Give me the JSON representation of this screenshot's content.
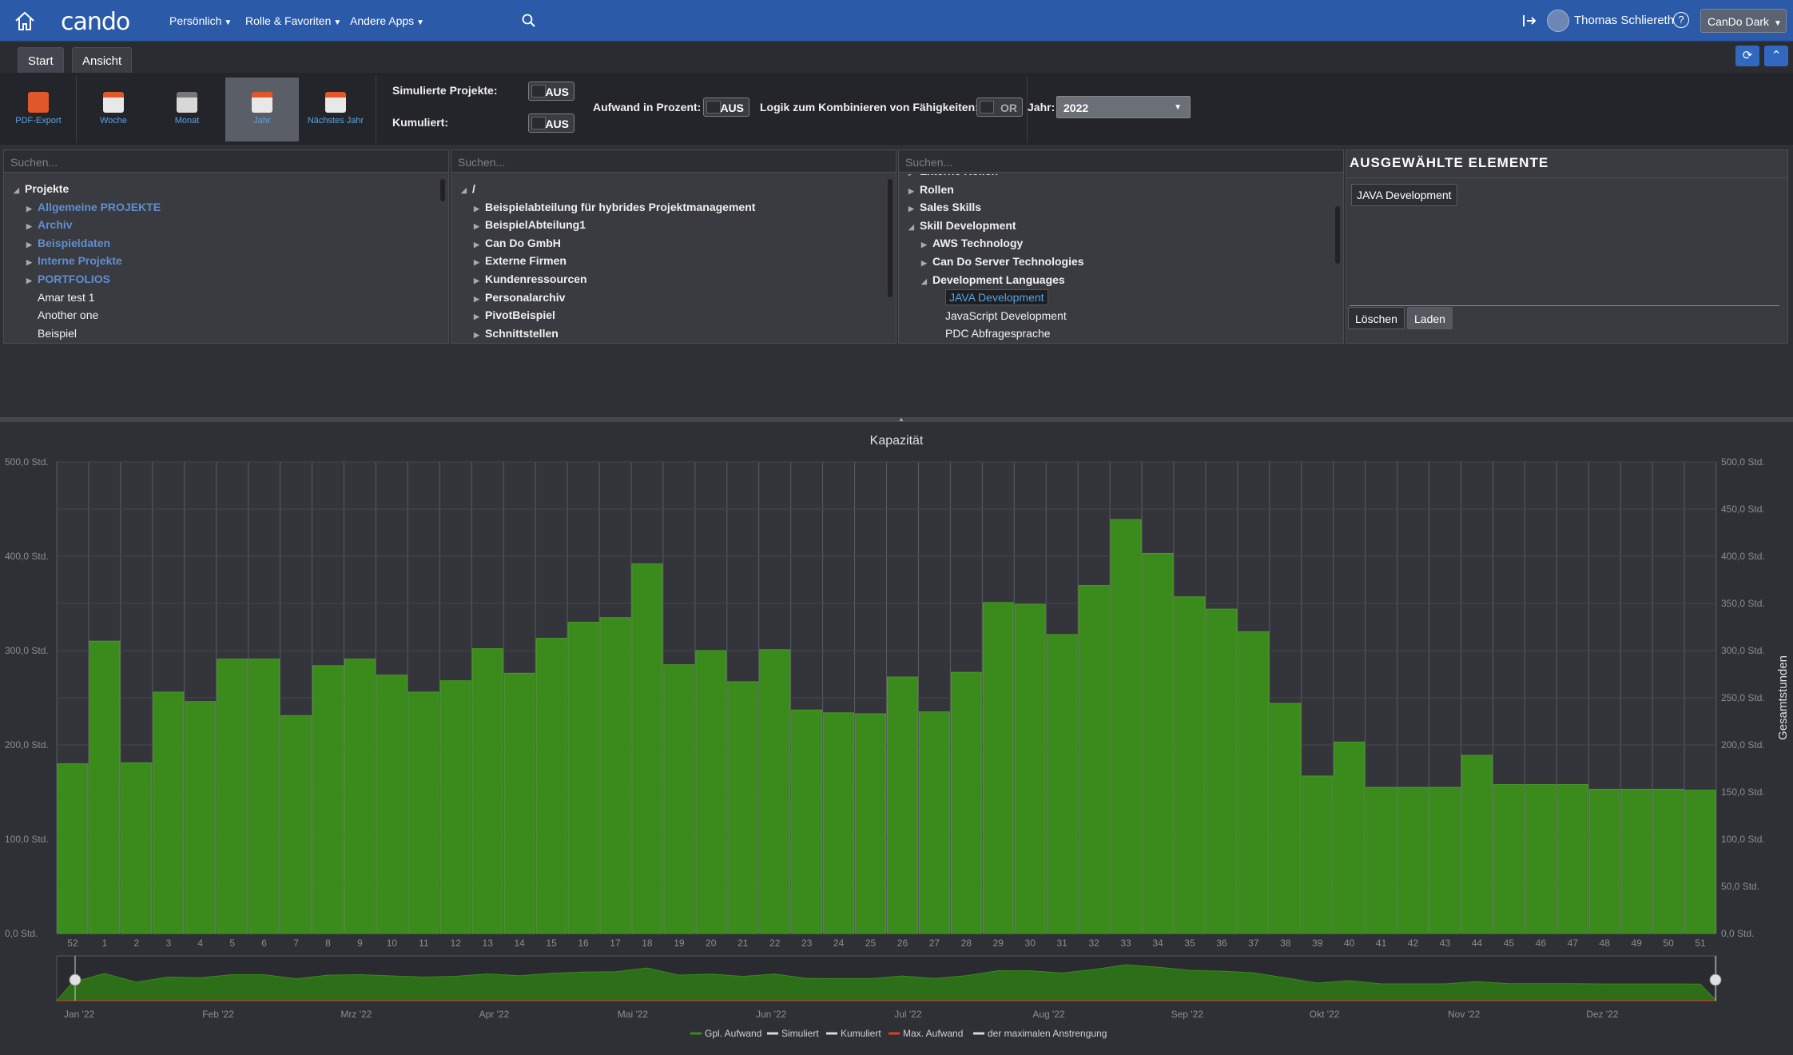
{
  "topbar": {
    "logo": "cando",
    "menus": [
      "Persönlich",
      "Rolle & Favoriten",
      "Andere Apps"
    ],
    "user": "Thomas Schliereth",
    "help": "?",
    "theme": "CanDo Dark"
  },
  "tabs": [
    "Start",
    "Ansicht"
  ],
  "ribbon": {
    "buttons": [
      {
        "label": "PDF-Export",
        "icon": "pdf-icon"
      },
      {
        "label": "Woche",
        "icon": "calendar-week-icon"
      },
      {
        "label": "Monat",
        "icon": "calendar-month-icon"
      },
      {
        "label": "Jahr",
        "icon": "calendar-year-icon"
      },
      {
        "label": "Nächstes Jahr",
        "icon": "calendar-next-year-icon"
      }
    ],
    "sim_label": "Simulierte Projekte:",
    "sim_value": "AUS",
    "cum_label": "Kumuliert:",
    "cum_value": "AUS",
    "pct_label": "Aufwand in Prozent:",
    "pct_value": "AUS",
    "logic_label": "Logik zum Kombinieren von Fähigkeiten:",
    "logic_value": "OR",
    "year_label": "Jahr:",
    "year_value": "2022"
  },
  "search_placeholder": "Suchen...",
  "panel1": [
    {
      "t": "Projekte",
      "lvl": 0,
      "arrow": "open",
      "style": "b"
    },
    {
      "t": "Allgemeine PROJEKTE",
      "lvl": 1,
      "arrow": "closed",
      "style": "link"
    },
    {
      "t": "Archiv",
      "lvl": 1,
      "arrow": "closed",
      "style": "link"
    },
    {
      "t": "Beispieldaten",
      "lvl": 1,
      "arrow": "closed",
      "style": "link"
    },
    {
      "t": "Interne Projekte",
      "lvl": 1,
      "arrow": "closed",
      "style": "link"
    },
    {
      "t": "PORTFOLIOS",
      "lvl": 1,
      "arrow": "closed",
      "style": "link"
    },
    {
      "t": "Amar test 1",
      "lvl": 1,
      "arrow": "none",
      "style": ""
    },
    {
      "t": "Another one",
      "lvl": 1,
      "arrow": "none",
      "style": ""
    },
    {
      "t": "Beispiel",
      "lvl": 1,
      "arrow": "none",
      "style": ""
    }
  ],
  "panel2": [
    {
      "t": "/",
      "lvl": 0,
      "arrow": "open",
      "style": "b"
    },
    {
      "t": "Beispielabteilung für hybrides Projektmanagement",
      "lvl": 1,
      "arrow": "closed",
      "style": "b"
    },
    {
      "t": "BeispielAbteilung1",
      "lvl": 1,
      "arrow": "closed",
      "style": "b"
    },
    {
      "t": "Can Do GmbH",
      "lvl": 1,
      "arrow": "closed",
      "style": "b"
    },
    {
      "t": "Externe Firmen",
      "lvl": 1,
      "arrow": "closed",
      "style": "b"
    },
    {
      "t": "Kundenressourcen",
      "lvl": 1,
      "arrow": "closed",
      "style": "b"
    },
    {
      "t": "Personalarchiv",
      "lvl": 1,
      "arrow": "closed",
      "style": "b"
    },
    {
      "t": "PivotBeispiel",
      "lvl": 1,
      "arrow": "closed",
      "style": "b"
    },
    {
      "t": "Schnittstellen",
      "lvl": 1,
      "arrow": "closed",
      "style": "b"
    }
  ],
  "panel3": [
    {
      "t": "Externe Rollen",
      "lvl": 0,
      "arrow": "closed",
      "style": "b"
    },
    {
      "t": "Rollen",
      "lvl": 0,
      "arrow": "closed",
      "style": "b"
    },
    {
      "t": "Sales Skills",
      "lvl": 0,
      "arrow": "closed",
      "style": "b"
    },
    {
      "t": "Skill Development",
      "lvl": 0,
      "arrow": "open",
      "style": "b"
    },
    {
      "t": "AWS Technology",
      "lvl": 1,
      "arrow": "closed",
      "style": "b"
    },
    {
      "t": "Can Do Server Technologies",
      "lvl": 1,
      "arrow": "closed",
      "style": "b"
    },
    {
      "t": "Development Languages",
      "lvl": 1,
      "arrow": "open",
      "style": "b"
    },
    {
      "t": "JAVA Development",
      "lvl": 2,
      "arrow": "none",
      "style": "sel"
    },
    {
      "t": "JavaScript Development",
      "lvl": 2,
      "arrow": "none",
      "style": ""
    },
    {
      "t": "PDC Abfragesprache",
      "lvl": 2,
      "arrow": "none",
      "style": ""
    }
  ],
  "selected": {
    "title": "AUSGEWÄHLTE ELEMENTE",
    "items": [
      "JAVA Development"
    ],
    "delete": "Löschen",
    "load": "Laden"
  },
  "chart_data": {
    "type": "bar",
    "title": "Kapazität",
    "ylabel_right": "Gesamtstunden",
    "left_ticks": [
      "0,0 Std.",
      "100,0 Std.",
      "200,0 Std.",
      "300,0 Std.",
      "400,0 Std.",
      "500,0 Std."
    ],
    "right_ticks": [
      "0,0 Std.",
      "50,0 Std.",
      "100,0 Std.",
      "150,0 Std.",
      "200,0 Std.",
      "250,0 Std.",
      "300,0 Std.",
      "350,0 Std.",
      "400,0 Std.",
      "450,0 Std.",
      "500,0 Std."
    ],
    "ylim": [
      0,
      500
    ],
    "categories": [
      "52",
      "1",
      "2",
      "3",
      "4",
      "5",
      "6",
      "7",
      "8",
      "9",
      "10",
      "11",
      "12",
      "13",
      "14",
      "15",
      "16",
      "17",
      "18",
      "19",
      "20",
      "21",
      "22",
      "23",
      "24",
      "25",
      "26",
      "27",
      "28",
      "29",
      "30",
      "31",
      "32",
      "33",
      "34",
      "35",
      "36",
      "37",
      "38",
      "39",
      "40",
      "41",
      "42",
      "43",
      "44",
      "45",
      "46",
      "47",
      "48",
      "49",
      "50",
      "51"
    ],
    "series": [
      {
        "name": "Gpl. Aufwand",
        "color": "#3a8a1c",
        "values": [
          180,
          310,
          181,
          256,
          246,
          291,
          291,
          231,
          284,
          291,
          274,
          256,
          268,
          302,
          276,
          313,
          330,
          335,
          392,
          285,
          300,
          267,
          301,
          237,
          234,
          233,
          272,
          235,
          277,
          351,
          349,
          317,
          369,
          439,
          403,
          357,
          344,
          320,
          244,
          167,
          203,
          155,
          155,
          155,
          189,
          158,
          158,
          158,
          153,
          153,
          153,
          152
        ]
      }
    ],
    "navigator_months": [
      "Jan '22",
      "Feb '22",
      "Mrz '22",
      "Apr '22",
      "Mai '22",
      "Jun '22",
      "Jul '22",
      "Aug '22",
      "Sep '22",
      "Okt '22",
      "Nov '22",
      "Dez '22"
    ],
    "legend": [
      {
        "name": "Gpl. Aufwand",
        "color": "#3a8a1c"
      },
      {
        "name": "Simuliert",
        "color": "#d9d9d9"
      },
      {
        "name": "Kumuliert",
        "color": "#d9d9d9"
      },
      {
        "name": "Max. Aufwand",
        "color": "#e03a2a"
      },
      {
        "name": "der maximalen Anstrengung",
        "color": "#d9d9d9"
      }
    ]
  }
}
